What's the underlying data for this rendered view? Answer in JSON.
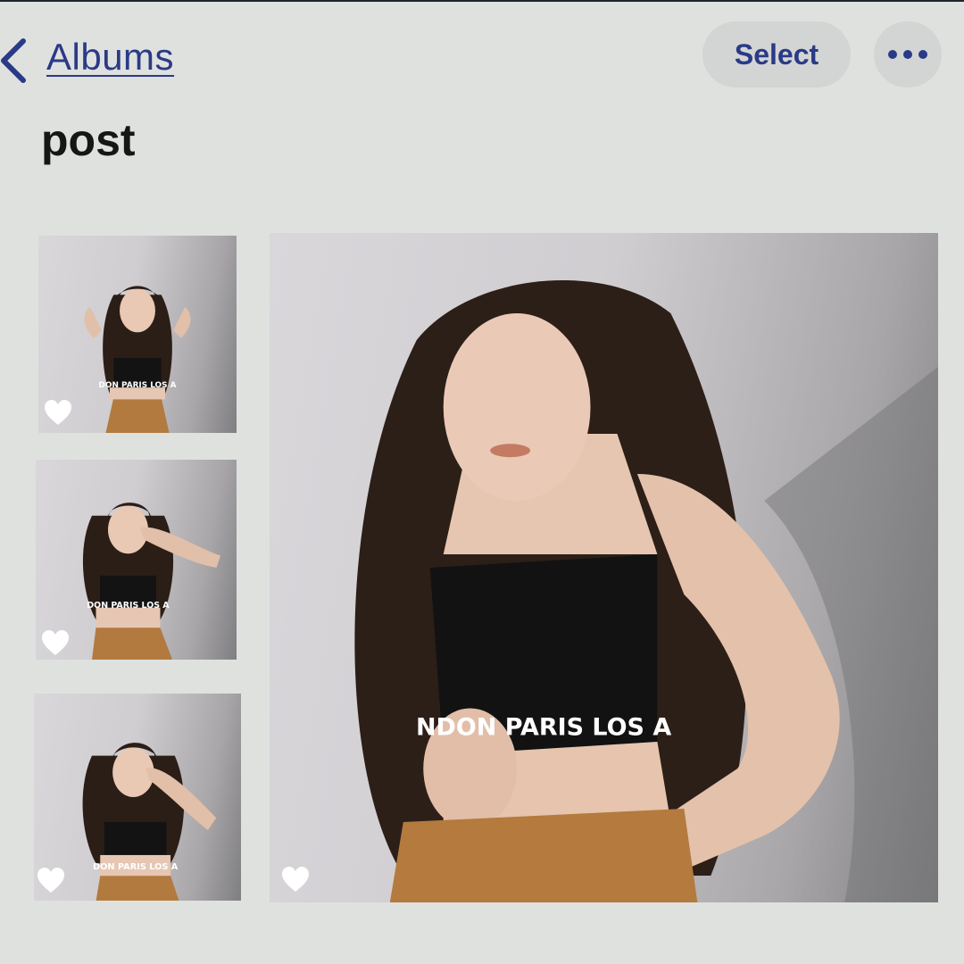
{
  "header": {
    "back_label": "Albums",
    "select_label": "Select"
  },
  "album": {
    "title": "post"
  },
  "photos": [
    {
      "favorite": true,
      "shirt_text": "DON PARIS LOS A"
    },
    {
      "favorite": true,
      "shirt_text": "DON PARIS LOS A"
    },
    {
      "favorite": true,
      "shirt_text": "DON PARIS LOS A"
    },
    {
      "favorite": true,
      "shirt_text": "NDON PARIS LOS A"
    }
  ],
  "icons": {
    "back": "chevron-left-icon",
    "more": "ellipsis-icon",
    "favorite": "heart-icon"
  },
  "colors": {
    "accent": "#2a3a86",
    "background": "#dfe1df",
    "button_bg": "#d3d5d4"
  }
}
